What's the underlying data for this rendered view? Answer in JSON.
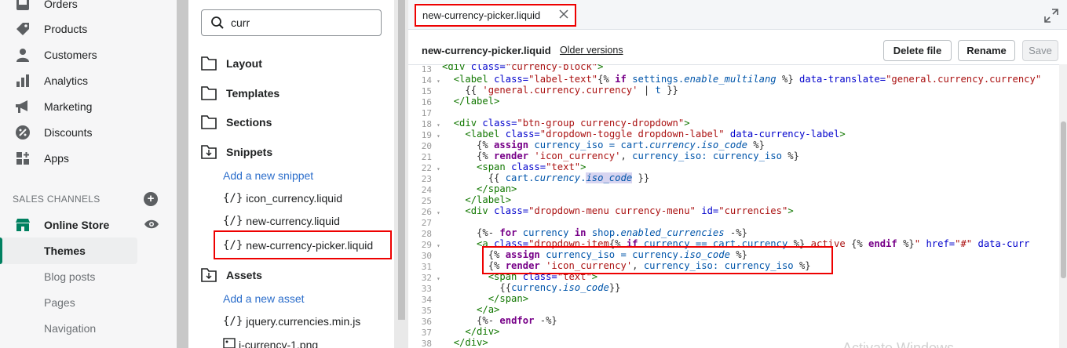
{
  "nav": {
    "items": [
      {
        "label": "Orders",
        "icon": "orders-icon"
      },
      {
        "label": "Products",
        "icon": "tag-icon"
      },
      {
        "label": "Customers",
        "icon": "person-icon"
      },
      {
        "label": "Analytics",
        "icon": "bar-chart-icon"
      },
      {
        "label": "Marketing",
        "icon": "megaphone-icon"
      },
      {
        "label": "Discounts",
        "icon": "discount-icon"
      },
      {
        "label": "Apps",
        "icon": "apps-icon"
      }
    ],
    "sales_channels_label": "SALES CHANNELS",
    "online_store": "Online Store",
    "sub_items": [
      "Themes",
      "Blog posts",
      "Pages",
      "Navigation"
    ]
  },
  "tree": {
    "search_value": "curr",
    "folders": [
      "Layout",
      "Templates",
      "Sections",
      "Snippets",
      "Assets"
    ],
    "add_snippet": "Add a new snippet",
    "snippets": [
      "icon_currency.liquid",
      "new-currency.liquid",
      "new-currency-picker.liquid"
    ],
    "add_asset": "Add a new asset",
    "assets": [
      "jquery.currencies.min.js",
      "i-currency-1.png"
    ]
  },
  "editor": {
    "tab_label": "new-currency-picker.liquid",
    "file_title": "new-currency-picker.liquid",
    "older_versions": "Older versions",
    "delete_label": "Delete file",
    "rename_label": "Rename",
    "save_label": "Save",
    "line_numbers": [
      "13",
      "14",
      "15",
      "16",
      "17",
      "18",
      "19",
      "20",
      "21",
      "22",
      "23",
      "24",
      "25",
      "26",
      "27",
      "28",
      "29",
      "30",
      "31",
      "32",
      "33",
      "34",
      "35",
      "36",
      "37",
      "38"
    ]
  },
  "colors": {
    "accent": "#008060",
    "highlight": "#ee0000",
    "link": "#2c6ecb"
  },
  "watermark": "Activate Windows"
}
